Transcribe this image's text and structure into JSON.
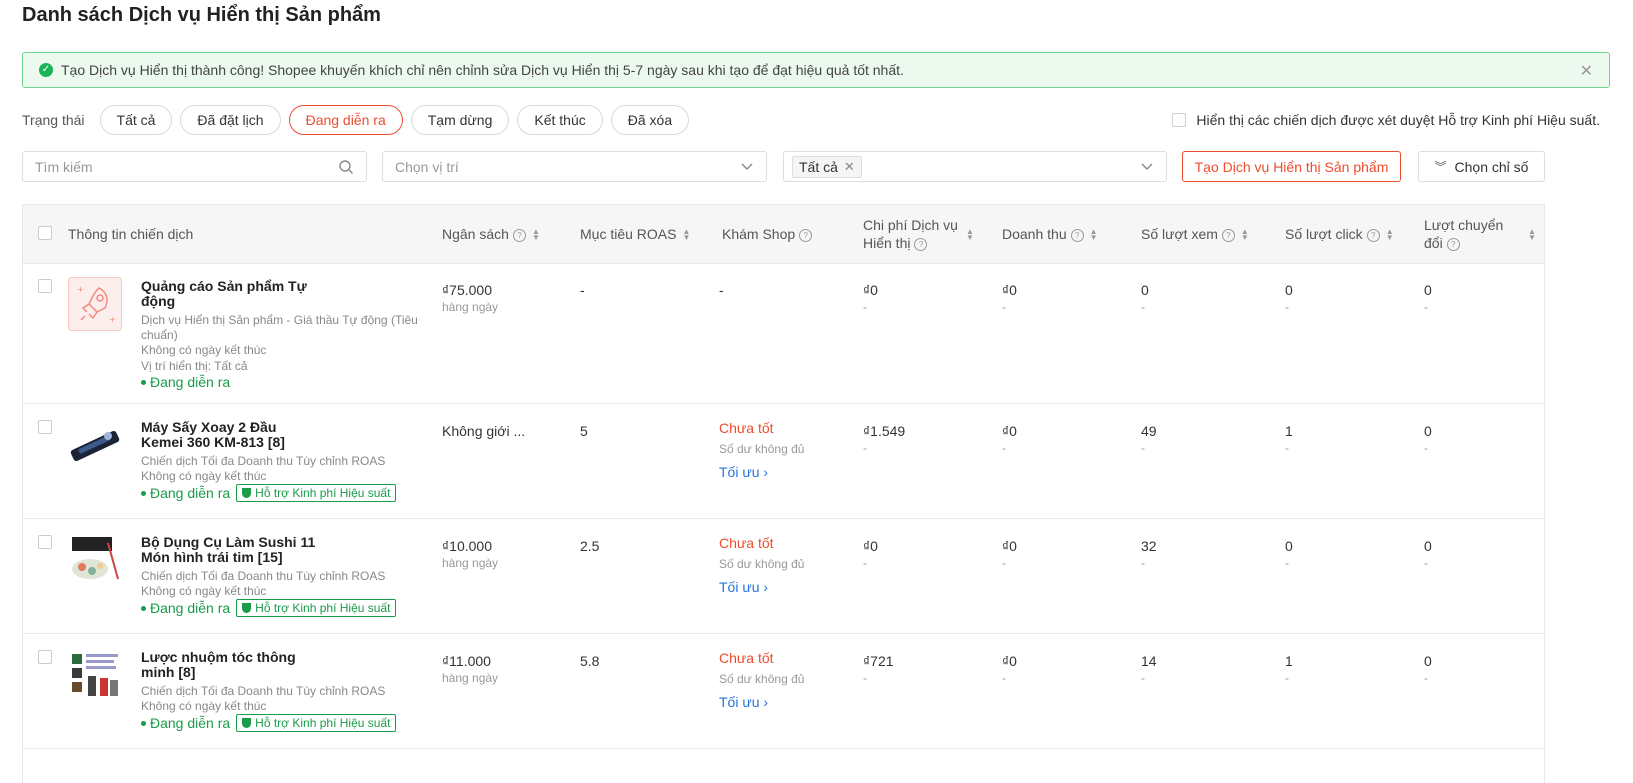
{
  "page_title": "Danh sách Dịch vụ Hiển thị Sản phẩm",
  "alert": {
    "text": "Tạo Dịch vụ Hiển thị thành công! Shopee khuyến khích chỉ nên chỉnh sửa Dịch vụ Hiển thị 5-7 ngày sau khi tạo để đạt hiệu quả tốt nhất.",
    "close": "✕"
  },
  "filters": {
    "label": "Trạng thái",
    "tabs": [
      "Tất cả",
      "Đã đặt lịch",
      "Đang diễn ra",
      "Tạm dừng",
      "Kết thúc",
      "Đã xóa"
    ],
    "active_tab": "Đang diễn ra",
    "support_checkbox_label": "Hiển thị các chiến dịch được xét duyệt Hỗ trợ Kinh phí Hiệu suất."
  },
  "search": {
    "placeholder": "Tìm kiếm"
  },
  "position_select": {
    "placeholder": "Chọn vị trí"
  },
  "tag_select": {
    "tag": "Tất cả"
  },
  "buttons": {
    "create": "Tạo Dịch vụ Hiển thị Sản phẩm",
    "metrics": "Chọn chỉ số"
  },
  "columns": {
    "info": "Thông tin chiến dịch",
    "budget": "Ngân sách",
    "roas": "Mục tiêu ROAS",
    "shop": "Khám Shop",
    "cost_1": "Chi phí Dịch vụ",
    "cost_2": "Hiển thị",
    "revenue": "Doanh thu",
    "views": "Số lượt xem",
    "clicks": "Số lượt click",
    "conv_1": "Lượt chuyển",
    "conv_2": "đổi"
  },
  "rows": [
    {
      "name_1": "Quảng cáo Sản phẩm Tự",
      "name_2": "động",
      "sub_1": "Dịch vụ Hiển thị Sản phẩm - Giá thầu Tự động (Tiêu",
      "sub_2": "chuẩn)",
      "sub_3": "Không có ngày kết thúc",
      "sub_4": "Vị trí hiển thị: Tất cả",
      "status": "Đang diễn ra",
      "budget": "₫75.000",
      "budget_sub": "hàng ngày",
      "roas": "-",
      "shop": "-",
      "cost": "₫0",
      "cost_sub": "-",
      "revenue": "₫0",
      "revenue_sub": "-",
      "views": "0",
      "views_sub": "-",
      "clicks": "0",
      "clicks_sub": "-",
      "conv": "0",
      "conv_sub": "-"
    },
    {
      "name_1": "Máy Sấy Xoay 2 Đầu",
      "name_2": "Kemei 360 KM-813 [8]",
      "sub_1": "Chiến dịch Tối đa Doanh thu Tùy chỉnh ROAS",
      "sub_2": "Không có ngày kết thúc",
      "status": "Đang diễn ra",
      "badge": "Hỗ trợ Kinh phí Hiệu suất",
      "budget": "Không giới ...",
      "roas": "5",
      "shop_status": "Chưa tốt",
      "shop_sub": "Số dư không đủ",
      "shop_link": "Tối ưu ›",
      "cost": "₫1.549",
      "cost_sub": "-",
      "revenue": "₫0",
      "revenue_sub": "-",
      "views": "49",
      "views_sub": "-",
      "clicks": "1",
      "clicks_sub": "-",
      "conv": "0",
      "conv_sub": "-"
    },
    {
      "name_1": "Bộ Dụng Cụ Làm Sushi 11",
      "name_2": "Món hình trái tim [15]",
      "sub_1": "Chiến dịch Tối đa Doanh thu Tùy chỉnh ROAS",
      "sub_2": "Không có ngày kết thúc",
      "status": "Đang diễn ra",
      "badge": "Hỗ trợ Kinh phí Hiệu suất",
      "budget": "₫10.000",
      "budget_sub": "hàng ngày",
      "roas": "2.5",
      "shop_status": "Chưa tốt",
      "shop_sub": "Số dư không đủ",
      "shop_link": "Tối ưu ›",
      "cost": "₫0",
      "cost_sub": "-",
      "revenue": "₫0",
      "revenue_sub": "-",
      "views": "32",
      "views_sub": "-",
      "clicks": "0",
      "clicks_sub": "-",
      "conv": "0",
      "conv_sub": "-"
    },
    {
      "name_1": "Lược nhuộm tóc thông",
      "name_2": "minh [8]",
      "sub_1": "Chiến dịch Tối đa Doanh thu Tùy chỉnh ROAS",
      "sub_2": "Không có ngày kết thúc",
      "status": "Đang diễn ra",
      "badge": "Hỗ trợ Kinh phí Hiệu suất",
      "budget": "₫11.000",
      "budget_sub": "hàng ngày",
      "roas": "5.8",
      "shop_status": "Chưa tốt",
      "shop_sub": "Số dư không đủ",
      "shop_link": "Tối ưu ›",
      "cost": "₫721",
      "cost_sub": "-",
      "revenue": "₫0",
      "revenue_sub": "-",
      "views": "14",
      "views_sub": "-",
      "clicks": "1",
      "clicks_sub": "-",
      "conv": "0",
      "conv_sub": "-"
    }
  ]
}
